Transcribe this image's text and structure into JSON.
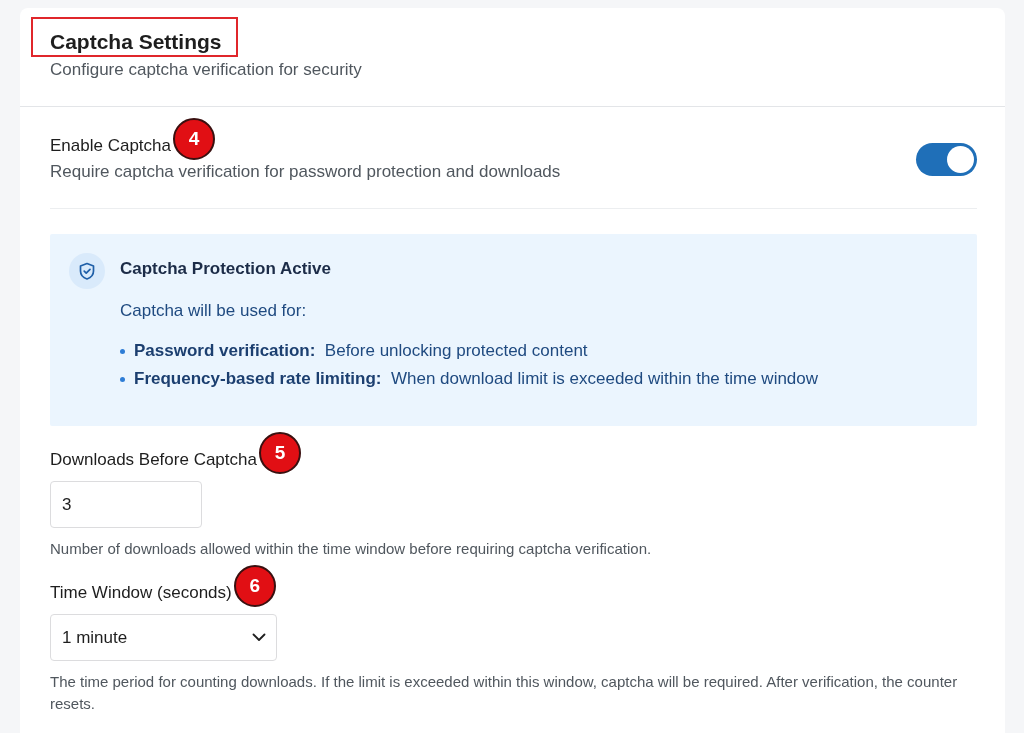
{
  "header": {
    "title": "Captcha Settings",
    "title_highlighted": true,
    "subtitle": "Configure captcha verification for security"
  },
  "enable_setting": {
    "label": "Enable Captcha",
    "callout": "4",
    "description": "Require captcha verification for password protection and downloads",
    "on": true
  },
  "info_box": {
    "title": "Captcha Protection Active",
    "intro": "Captcha will be used for:",
    "items": [
      {
        "text": "**Password verification:**  Before unlocking protected content"
      },
      {
        "text": "**Frequency-based rate limiting:**  When download limit is exceeded within the time window"
      }
    ]
  },
  "fields": [
    {
      "kind": "number",
      "label": "Downloads Before Captcha",
      "callout": "5",
      "value": "3",
      "help": "Number of downloads allowed within the time window before requiring captcha verification."
    },
    {
      "kind": "select",
      "label": "Time Window (seconds)",
      "callout": "6",
      "value": "1 minute",
      "help": "The time period for counting downloads. If the limit is exceeded within this window, captcha will be required. After verification, the counter resets."
    }
  ]
}
